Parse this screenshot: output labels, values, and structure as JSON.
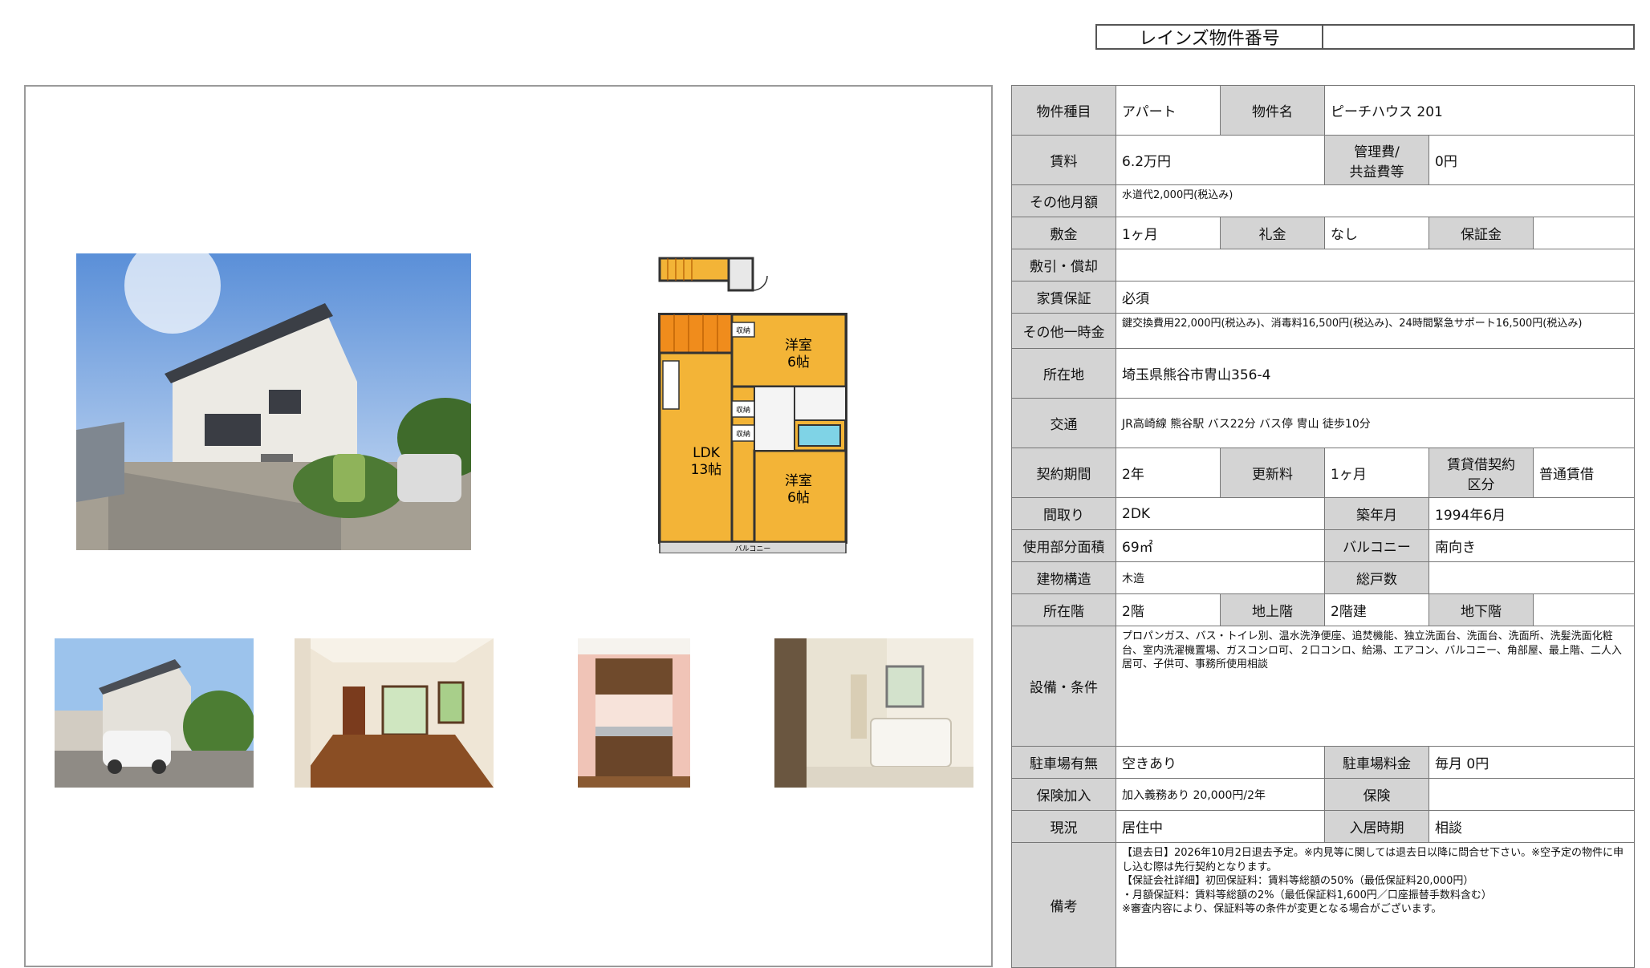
{
  "reins": {
    "label": "レインズ物件番号",
    "value": ""
  },
  "floorplan": {
    "room1": "洋室",
    "room1_size": "6帖",
    "room2": "洋室",
    "room2_size": "6帖",
    "ldk": "LDK",
    "ldk_size": "13帖",
    "storage": "収納",
    "balcony": "バルコニー"
  },
  "table": {
    "type_label": "物件種目",
    "type": "アパート",
    "name_label": "物件名",
    "name": "ピーチハウス 201",
    "rent_label": "賃料",
    "rent": "6.2万円",
    "mgmt_label": "管理費/\n共益費等",
    "mgmt": "0円",
    "other_monthly_label": "その他月額",
    "other_monthly": "水道代2,000円(税込み)",
    "deposit_label": "敷金",
    "deposit": "1ヶ月",
    "key_money_label": "礼金",
    "key_money": "なし",
    "guarantee_money_label": "保証金",
    "guarantee_money": "",
    "deduction_label": "敷引・償却",
    "deduction": "",
    "rent_guarantee_label": "家賃保証",
    "rent_guarantee": "必須",
    "other_onetime_label": "その他一時金",
    "other_onetime": "鍵交換費用22,000円(税込み)、消毒料16,500円(税込み)、24時間緊急サポート16,500円(税込み)",
    "address_label": "所在地",
    "address": "埼玉県熊谷市冑山356-4",
    "transport_label": "交通",
    "transport": "JR高崎線 熊谷駅 バス22分 バス停 冑山 徒歩10分",
    "contract_period_label": "契約期間",
    "contract_period": "2年",
    "renewal_label": "更新料",
    "renewal": "1ヶ月",
    "lease_type_label": "賃貸借契約\n区分",
    "lease_type": "普通賃借",
    "layout_label": "間取り",
    "layout": "2DK",
    "built_label": "築年月",
    "built": "1994年6月",
    "area_label": "使用部分面積",
    "area": "69㎡",
    "balcony_label": "バルコニー",
    "balcony": "南向き",
    "structure_label": "建物構造",
    "structure": "木造",
    "units_label": "総戸数",
    "units": "",
    "floor_label": "所在階",
    "floor": "2階",
    "above_label": "地上階",
    "above": "2階建",
    "below_label": "地下階",
    "below": "",
    "facilities_label": "設備・条件",
    "facilities": "プロパンガス、バス・トイレ別、温水洗浄便座、追焚機能、独立洗面台、洗面台、洗面所、洗髪洗面化粧台、室内洗濯機置場、ガスコンロ可、２口コンロ、給湯、エアコン、バルコニー、角部屋、最上階、二人入居可、子供可、事務所使用相談",
    "parking_label": "駐車場有無",
    "parking": "空きあり",
    "parking_fee_label": "駐車場料金",
    "parking_fee": "毎月 0円",
    "insurance_label": "保険加入",
    "insurance": "加入義務あり 20,000円/2年",
    "hoken_label": "保険",
    "hoken": "",
    "status_label": "現況",
    "status": "居住中",
    "movein_label": "入居時期",
    "movein": "相談",
    "remarks_label": "備考",
    "remarks": "【退去日】2026年10月2日退去予定。※内見等に関しては退去日以降に問合せ下さい。※空予定の物件に申し込む際は先行契約となります。\n【保証会社詳細】初回保証料：賃料等総額の50%（最低保証料20,000円）\n・月額保証料：賃料等総額の2%（最低保証料1,600円／口座振替手数料含む）\n※審査内容により、保証料等の条件が変更となる場合がございます。"
  },
  "colors": {
    "header_bg": "#d4d4d4",
    "floor_wood": "#f3b437",
    "border": "#777777"
  }
}
